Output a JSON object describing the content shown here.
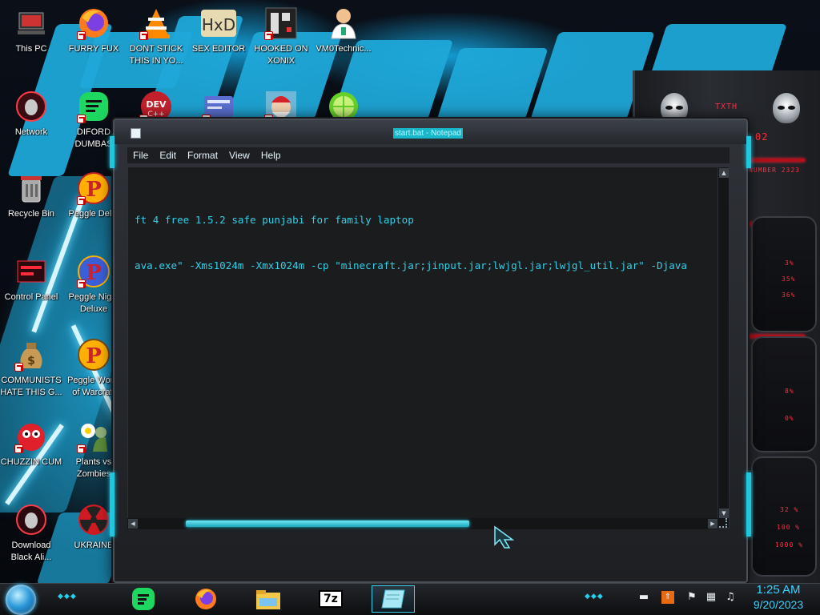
{
  "desktop": {
    "icons": [
      {
        "label": "This PC",
        "icon": "this-pc-icon"
      },
      {
        "label": "FURRY FUX",
        "icon": "firefox-icon"
      },
      {
        "label": "DONT STICK THIS IN YO...",
        "icon": "vlc-icon"
      },
      {
        "label": "SEX EDITOR",
        "icon": "hex-editor-icon"
      },
      {
        "label": "HOOKED ON XONIX",
        "icon": "xonix-game-icon"
      },
      {
        "label": "VM0Technic...",
        "icon": "doctor-icon"
      },
      {
        "label": "Network",
        "icon": "network-alien-icon"
      },
      {
        "label": "DIFORD DUMBAS",
        "icon": "chat-app-icon"
      },
      {
        "label": "",
        "icon": "dev-cpp-icon"
      },
      {
        "label": "",
        "icon": "id-card-icon"
      },
      {
        "label": "",
        "icon": "santa-icon"
      },
      {
        "label": "",
        "icon": "lime-icon"
      },
      {
        "label": "Recycle Bin",
        "icon": "recycle-bin-icon"
      },
      {
        "label": "Peggle Del...",
        "icon": "peggle-icon"
      },
      {
        "label": "Control Panel",
        "icon": "control-panel-icon"
      },
      {
        "label": "Peggle Night Deluxe",
        "icon": "peggle-nights-icon"
      },
      {
        "label": "COMMUNISTS HATE THIS G...",
        "icon": "money-bag-icon"
      },
      {
        "label": "Peggle World of Warcraft",
        "icon": "peggle-wow-icon"
      },
      {
        "label": "CHUZZIN CUM",
        "icon": "chuzzle-icon"
      },
      {
        "label": "Plants vs Zombies",
        "icon": "plants-vs-zombies-icon"
      },
      {
        "label": "Download Black Ali...",
        "icon": "download-alien-icon"
      },
      {
        "label": "UKRAINE",
        "icon": "radiation-icon"
      }
    ]
  },
  "widget": {
    "header": "TXTH",
    "readout_top": "02",
    "readout_sub": "NUMBER 2323",
    "values": [
      "3%",
      "35%",
      "36%",
      "8%",
      "0%",
      "32 %",
      "100 %",
      "1000 %"
    ]
  },
  "notepad": {
    "title": "start.bat - Notepad",
    "menu": [
      "File",
      "Edit",
      "Format",
      "View",
      "Help"
    ],
    "lines": [
      "ft 4 free 1.5.2 safe punjabi for family laptop",
      "ava.exe\" -Xms1024m -Xmx1024m -cp \"minecraft.jar;jinput.jar;lwjgl.jar;lwjgl_util.jar\" -Djava"
    ],
    "scroll_position": 0.5
  },
  "taskbar": {
    "pinned": [
      {
        "icon": "chat-app-icon"
      },
      {
        "icon": "firefox-icon"
      },
      {
        "icon": "file-explorer-icon"
      },
      {
        "icon": "7zip-icon",
        "label": "7z"
      },
      {
        "icon": "notepad-icon",
        "active": true
      }
    ],
    "tray": [
      "chevron-icon",
      "flag-icon",
      "network-icon",
      "volume-icon"
    ],
    "clock_time": "1:25 AM",
    "clock_date": "9/20/2023"
  },
  "colors": {
    "accent": "#1fd3ee",
    "text_cyan": "#32d0e8",
    "alert_red": "#ff3040"
  }
}
